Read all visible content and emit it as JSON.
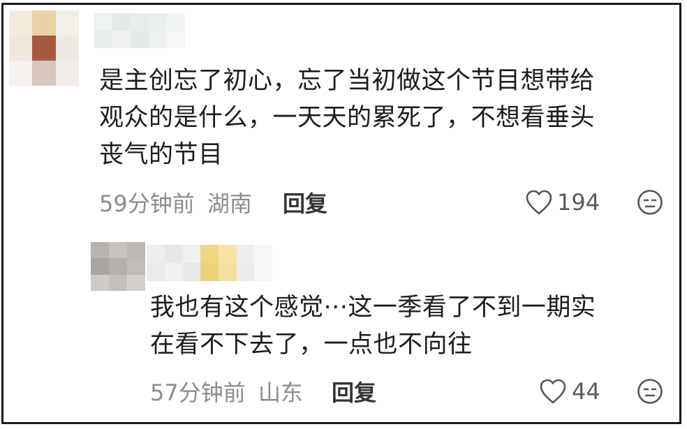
{
  "comments": [
    {
      "text_lines": [
        "是主创忘了初心，忘了当初做这个节目想带给",
        "观众的是什么，一天天的累死了，不想看垂头",
        "丧气的节目"
      ],
      "time": "59分钟前",
      "location": "湖南",
      "reply_label": "回复",
      "likes": "194",
      "avatar_icon": "blurred-avatar",
      "like_icon": "heart-outline-icon",
      "react_icon": "neutral-face-icon"
    },
    {
      "text_lines": [
        "我也有这个感觉···这一季看了不到一期实",
        "在看不下去了，一点也不向往"
      ],
      "time": "57分钟前",
      "location": "山东",
      "reply_label": "回复",
      "likes": "44",
      "avatar_icon": "blurred-avatar",
      "like_icon": "heart-outline-icon",
      "react_icon": "neutral-face-icon"
    }
  ],
  "colors": {
    "text": "#1c1c1c",
    "meta": "#8c8c8c",
    "border": "#1a1a1a"
  }
}
